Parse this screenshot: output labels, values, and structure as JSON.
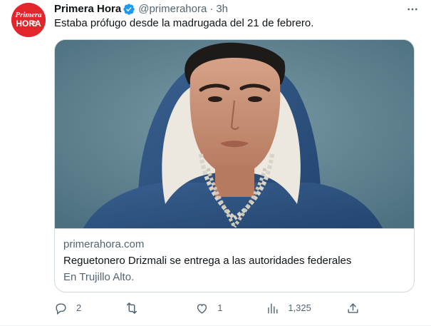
{
  "tweet": {
    "display_name": "Primera Hora",
    "handle": "@primerahora",
    "separator": "·",
    "time": "3h",
    "text": "Estaba prófugo desde la madrugada del 21 de febrero.",
    "avatar_brand_text_top": "Primera",
    "avatar_brand_text_bottom": "HORA"
  },
  "card": {
    "domain": "primerahora.com",
    "title": "Reguetonero Drizmali se entrega a las autoridades federales",
    "description": "En Trujillo Alto."
  },
  "actions": {
    "reply_count": "2",
    "retweet_count": "",
    "like_count": "1",
    "views_count": "1,325"
  },
  "colors": {
    "brand_red": "#e3262b",
    "verified_blue": "#1d9bf0",
    "text_primary": "#0f1419",
    "text_secondary": "#536471",
    "border": "#cfd9de",
    "image_background": "#5e8290"
  },
  "icons": {
    "verified": "verified-badge-icon",
    "more": "more-horizontal-icon",
    "reply": "reply-bubble-icon",
    "retweet": "retweet-icon",
    "like": "heart-icon",
    "views": "views-bar-chart-icon",
    "share": "share-upload-icon"
  }
}
